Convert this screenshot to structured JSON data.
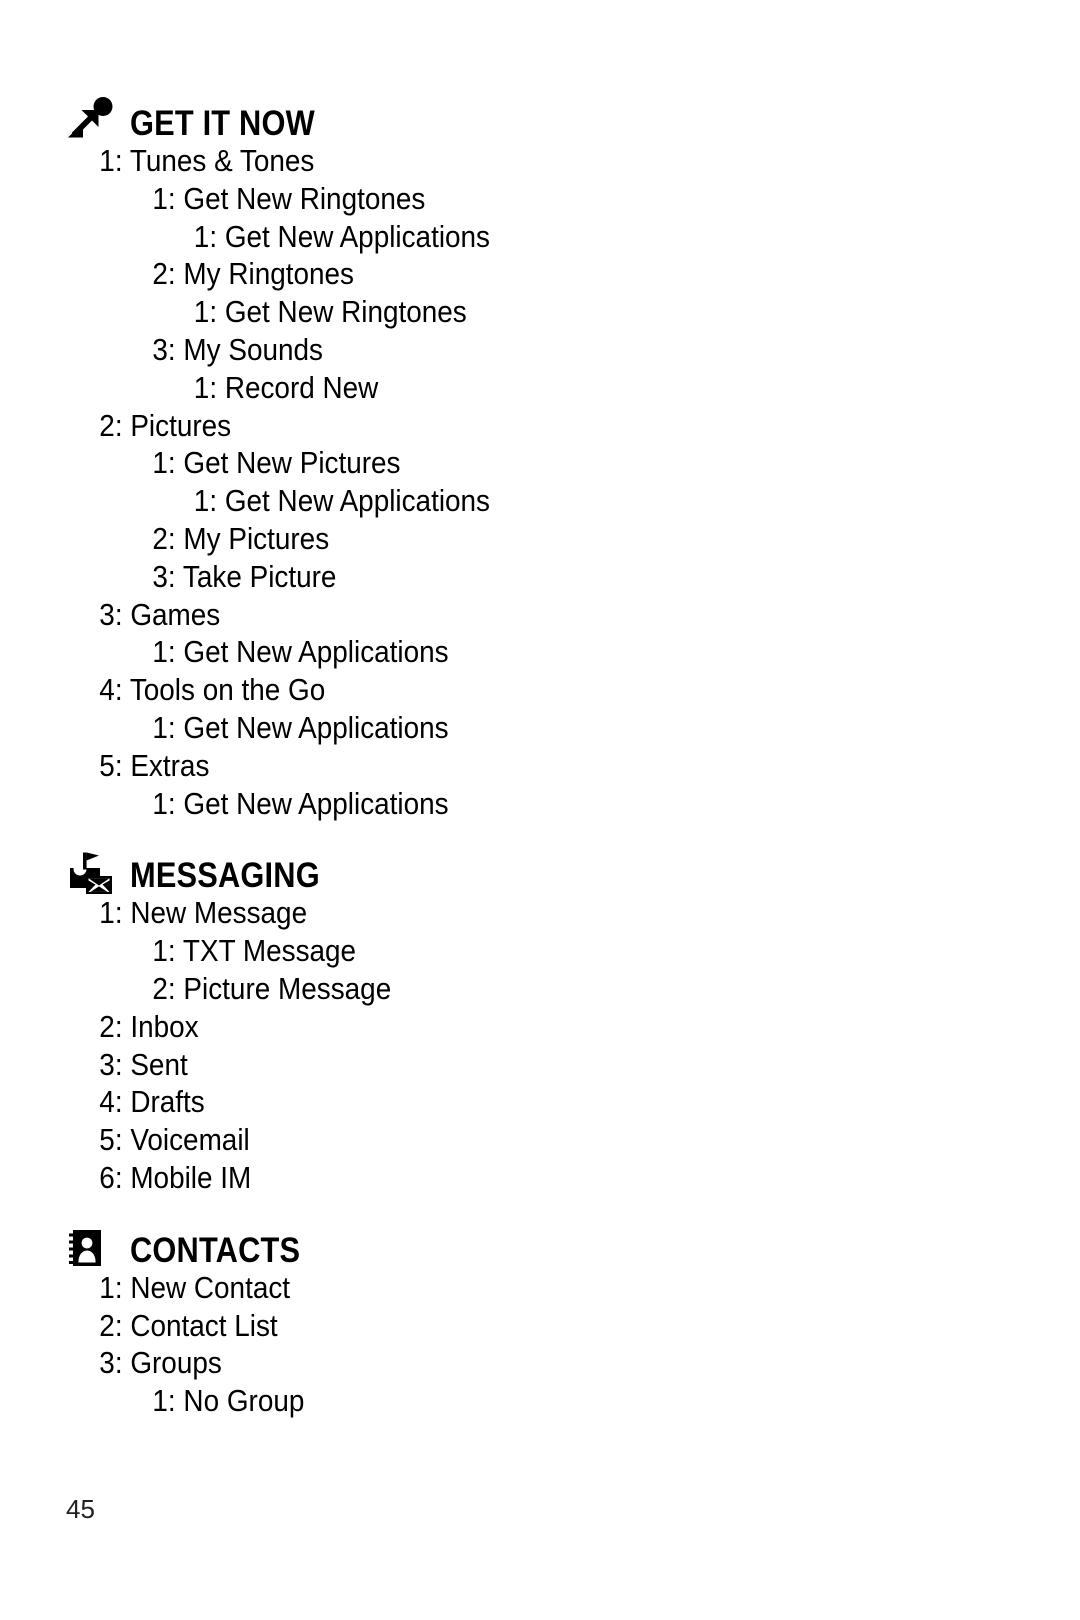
{
  "page": {
    "number": "45"
  },
  "sections": [
    {
      "id": "get-it-now",
      "title": "GET IT NOW",
      "icon": "arrow-ball-icon",
      "items": [
        {
          "level": 1,
          "text": "1: Tunes & Tones"
        },
        {
          "level": 2,
          "text": "1: Get New Ringtones"
        },
        {
          "level": 3,
          "text": "1: Get New Applications"
        },
        {
          "level": 2,
          "text": "2: My Ringtones"
        },
        {
          "level": 3,
          "text": "1: Get New Ringtones"
        },
        {
          "level": 2,
          "text": "3: My Sounds"
        },
        {
          "level": 3,
          "text": "1: Record New"
        },
        {
          "level": 1,
          "text": "2: Pictures"
        },
        {
          "level": 2,
          "text": "1: Get New Pictures"
        },
        {
          "level": 3,
          "text": "1: Get New Applications"
        },
        {
          "level": 2,
          "text": "2: My Pictures"
        },
        {
          "level": 2,
          "text": "3: Take Picture"
        },
        {
          "level": 1,
          "text": "3: Games"
        },
        {
          "level": 2,
          "text": "1: Get New Applications"
        },
        {
          "level": 1,
          "text": "4: Tools on the Go"
        },
        {
          "level": 2,
          "text": "1: Get New Applications"
        },
        {
          "level": 1,
          "text": "5: Extras"
        },
        {
          "level": 2,
          "text": "1: Get New Applications"
        }
      ]
    },
    {
      "id": "messaging",
      "title": "MESSAGING",
      "icon": "mailbox-envelope-icon",
      "items": [
        {
          "level": 1,
          "text": "1: New Message"
        },
        {
          "level": 2,
          "text": "1: TXT Message"
        },
        {
          "level": 2,
          "text": "2: Picture Message"
        },
        {
          "level": 1,
          "text": "2: Inbox"
        },
        {
          "level": 1,
          "text": "3: Sent"
        },
        {
          "level": 1,
          "text": "4: Drafts"
        },
        {
          "level": 1,
          "text": "5: Voicemail"
        },
        {
          "level": 1,
          "text": "6: Mobile IM"
        }
      ]
    },
    {
      "id": "contacts",
      "title": "CONTACTS",
      "icon": "address-book-person-icon",
      "items": [
        {
          "level": 1,
          "text": "1: New Contact"
        },
        {
          "level": 1,
          "text": "2: Contact List"
        },
        {
          "level": 1,
          "text": "3: Groups"
        },
        {
          "level": 2,
          "text": "1: No Group"
        }
      ]
    }
  ]
}
